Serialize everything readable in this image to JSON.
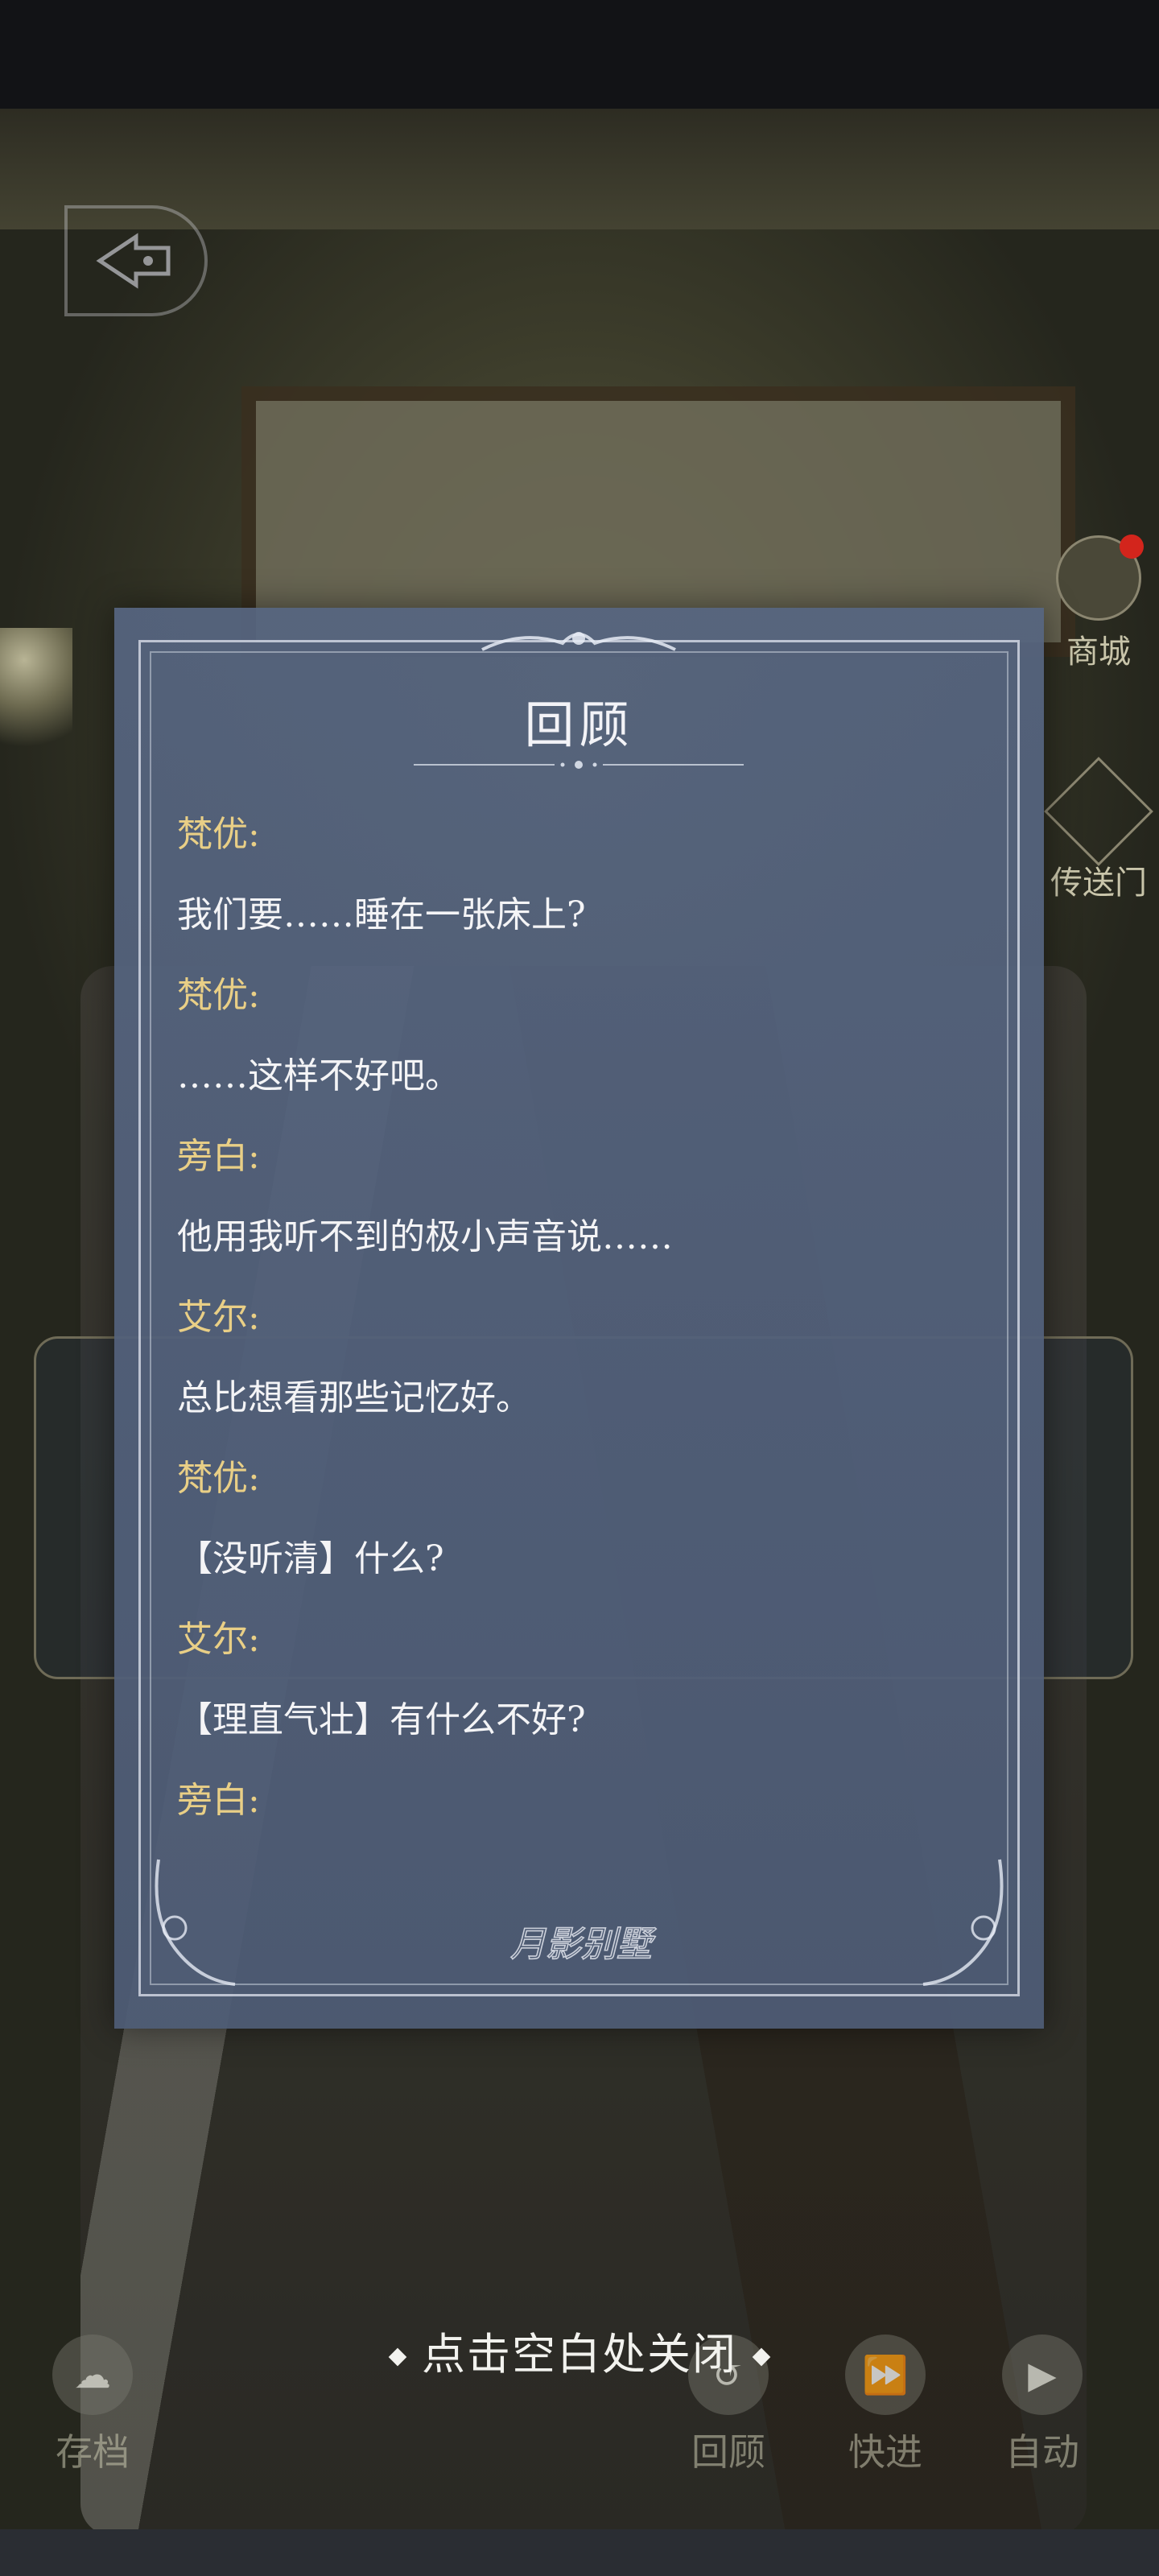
{
  "side_menu": {
    "shop_label": "商城",
    "portal_label": "传送门"
  },
  "review": {
    "title": "回顾",
    "lines": [
      {
        "kind": "speaker",
        "text": "梵优:"
      },
      {
        "kind": "text",
        "text": "我们要……睡在一张床上?"
      },
      {
        "kind": "speaker",
        "text": "梵优:"
      },
      {
        "kind": "text",
        "text": "……这样不好吧。"
      },
      {
        "kind": "speaker",
        "text": "旁白:"
      },
      {
        "kind": "text",
        "text": "他用我听不到的极小声音说……"
      },
      {
        "kind": "speaker",
        "text": "艾尔:"
      },
      {
        "kind": "text",
        "text": "总比想看那些记忆好。"
      },
      {
        "kind": "speaker",
        "text": "梵优:"
      },
      {
        "kind": "text",
        "text": "【没听清】什么?"
      },
      {
        "kind": "speaker",
        "text": "艾尔:"
      },
      {
        "kind": "text",
        "text": "【理直气壮】有什么不好?"
      },
      {
        "kind": "speaker",
        "text": "旁白:"
      }
    ],
    "logo_text": "月影别墅"
  },
  "hint": {
    "close_text": "点击空白处关闭"
  },
  "controls": {
    "save_label": "存档",
    "review_label": "回顾",
    "fast_forward_label": "快进",
    "auto_label": "自动"
  },
  "colors": {
    "speaker": "#e9cf86",
    "text": "#f4f4f6",
    "panel": "#566580",
    "notification": "#d3251c"
  }
}
